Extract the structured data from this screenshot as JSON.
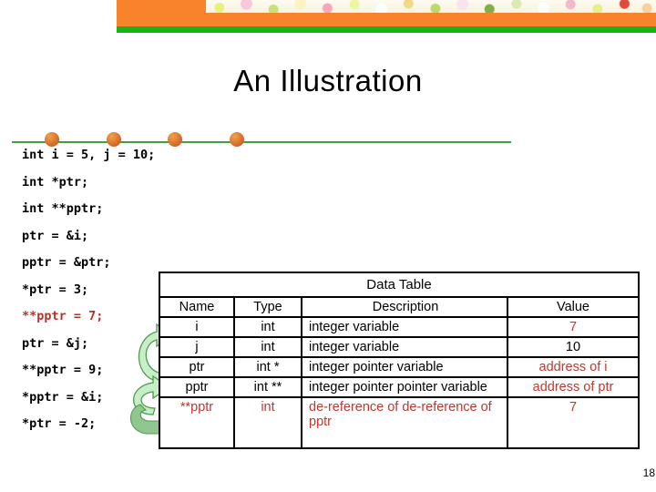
{
  "banner": {
    "orange_color": "#f9832c",
    "green_color": "#19b219",
    "photo_strip_label": "floral-photo-strip"
  },
  "slide": {
    "title": "An Illustration",
    "page_number": "18",
    "accent_red": "#c0372e",
    "rule_color": "#45a045",
    "dot_color": "#d4682a",
    "arrow_fill": "#c8eec8",
    "arrow_stroke": "#4f9c4f"
  },
  "code": {
    "lines": [
      {
        "text": "int i = 5, j = 10;",
        "highlight": false
      },
      {
        "text": "int *ptr;",
        "highlight": false
      },
      {
        "text": "int **pptr;",
        "highlight": false
      },
      {
        "text": "ptr = &i;",
        "highlight": false
      },
      {
        "text": "pptr = &ptr;",
        "highlight": false
      },
      {
        "text": "*ptr = 3;",
        "highlight": false
      },
      {
        "text": "**pptr = 7;",
        "highlight": true
      },
      {
        "text": "ptr = &j;",
        "highlight": false
      },
      {
        "text": "**pptr = 9;",
        "highlight": false
      },
      {
        "text": "*pptr = &i;",
        "highlight": false
      },
      {
        "text": "*ptr = -2;",
        "highlight": false
      }
    ]
  },
  "table": {
    "caption": "Data Table",
    "columns": [
      "Name",
      "Type",
      "Description",
      "Value"
    ],
    "rows": [
      {
        "name": "i",
        "type": "int",
        "description": "integer variable",
        "value": "7",
        "red": false,
        "value_red": true
      },
      {
        "name": "j",
        "type": "int",
        "description": "integer variable",
        "value": "10",
        "red": false,
        "value_red": false
      },
      {
        "name": "ptr",
        "type": "int *",
        "description": "integer pointer variable",
        "value": "address of i",
        "red": false,
        "value_red": true
      },
      {
        "name": "pptr",
        "type": "int **",
        "description": "integer pointer pointer variable",
        "value": "address of ptr",
        "red": false,
        "value_red": true
      },
      {
        "name": "**pptr",
        "type": "int",
        "description": "de-reference of de-reference of pptr",
        "value": "7",
        "red": true,
        "value_red": true
      }
    ]
  }
}
